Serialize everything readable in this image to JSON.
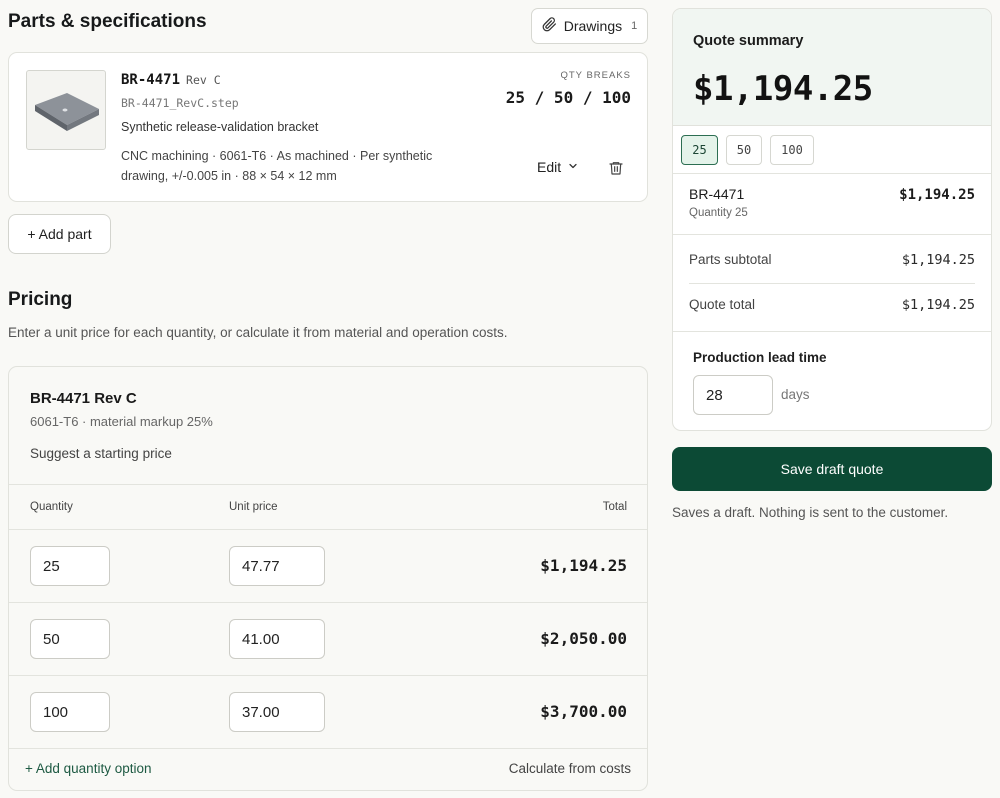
{
  "parts": {
    "title": "Parts & specifications",
    "drawings_button": {
      "label": "Drawings",
      "count": "1"
    },
    "part": {
      "number": "BR-4471",
      "rev": "Rev C",
      "file": "BR-4471_RevC.step",
      "description": "Synthetic release-validation bracket",
      "spec_line1": "CNC machining · 6061-T6 · As machined · Per synthetic",
      "spec_line2": "drawing, +/-0.005 in · 88 × 54 × 12 mm",
      "qty_breaks_label": "QTY BREAKS",
      "qty_breaks": "25 / 50 / 100",
      "edit_label": "Edit"
    },
    "add_part_label": "+ Add part"
  },
  "pricing": {
    "title": "Pricing",
    "description": "Enter a unit price for each quantity, or calculate it from material and operation costs.",
    "card": {
      "title": "BR-4471 Rev C",
      "subtitle": "6061-T6 · material markup 25%",
      "suggest_label": "Suggest a starting price",
      "columns": {
        "quantity": "Quantity",
        "unit_price": "Unit price",
        "total": "Total"
      },
      "rows": [
        {
          "quantity": "25",
          "unit_price": "47.77",
          "total": "$1,194.25"
        },
        {
          "quantity": "50",
          "unit_price": "41.00",
          "total": "$2,050.00"
        },
        {
          "quantity": "100",
          "unit_price": "37.00",
          "total": "$3,700.00"
        }
      ],
      "add_quantity_label": "+ Add quantity option",
      "calculate_label": "Calculate from costs"
    }
  },
  "summary": {
    "title": "Quote summary",
    "amount": "$1,194.25",
    "qty_tabs": [
      "25",
      "50",
      "100"
    ],
    "active_qty": "25",
    "line": {
      "name": "BR-4471",
      "quantity": "Quantity 25",
      "price": "$1,194.25"
    },
    "parts_subtotal_label": "Parts subtotal",
    "parts_subtotal": "$1,194.25",
    "quote_total_label": "Quote total",
    "quote_total": "$1,194.25",
    "lead_time_label": "Production lead time",
    "lead_time_value": "28",
    "lead_time_unit": "days"
  },
  "actions": {
    "save_label": "Save draft quote",
    "save_note": "Saves a draft. Nothing is sent to the customer."
  },
  "colors": {
    "accent": "#0c4a35",
    "accent_light": "#e4f3ea",
    "summary_header_bg": "#f1f6f2",
    "link": "#1e5a43"
  }
}
